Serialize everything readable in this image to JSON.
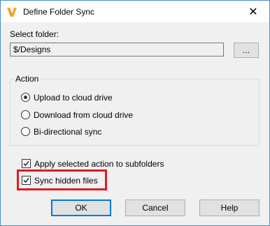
{
  "window": {
    "title": "Define Folder Sync",
    "close_glyph": "✕"
  },
  "folder": {
    "label": "Select folder:",
    "value": "$/Designs",
    "browse_label": "..."
  },
  "action": {
    "group_label": "Action",
    "options": [
      {
        "label": "Upload to cloud drive",
        "selected": true
      },
      {
        "label": "Download from cloud drive",
        "selected": false
      },
      {
        "label": "Bi-directional sync",
        "selected": false
      }
    ]
  },
  "options": {
    "apply_subfolders": {
      "label": "Apply selected action to subfolders",
      "checked": true
    },
    "sync_hidden": {
      "label": "Sync hidden files",
      "checked": true
    }
  },
  "buttons": {
    "ok": "OK",
    "cancel": "Cancel",
    "help": "Help"
  },
  "colors": {
    "accent_border": "#4a8ccc",
    "highlight": "#e01b24",
    "logo": "#f2a81d"
  }
}
